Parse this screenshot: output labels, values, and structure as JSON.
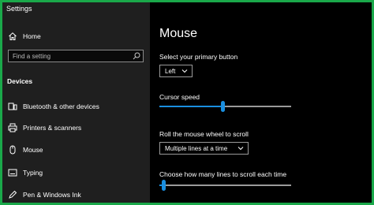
{
  "window": {
    "title": "Settings"
  },
  "sidebar": {
    "home_label": "Home",
    "search_placeholder": "Find a setting",
    "section_title": "Devices",
    "items": [
      {
        "label": "Bluetooth & other devices",
        "icon": "bluetooth-devices-icon"
      },
      {
        "label": "Printers & scanners",
        "icon": "printer-icon"
      },
      {
        "label": "Mouse",
        "icon": "mouse-icon"
      },
      {
        "label": "Typing",
        "icon": "keyboard-icon"
      },
      {
        "label": "Pen & Windows Ink",
        "icon": "pen-icon"
      }
    ]
  },
  "main": {
    "title": "Mouse",
    "primary_button": {
      "label": "Select your primary button",
      "value": "Left"
    },
    "cursor_speed": {
      "label": "Cursor speed",
      "level": 0.48
    },
    "scroll": {
      "label": "Roll the mouse wheel to scroll",
      "value": "Multiple lines at a time"
    },
    "lines": {
      "label": "Choose how many lines to scroll each time",
      "level": 0.03
    }
  },
  "colors": {
    "accent": "#1a8fe0",
    "sidebar_bg": "#1f1f1f",
    "content_bg": "#000000",
    "frame": "#1aa84a"
  }
}
